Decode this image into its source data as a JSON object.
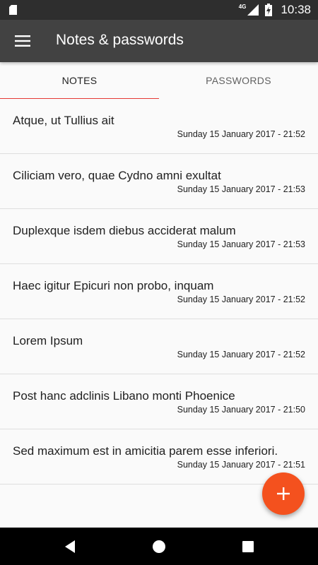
{
  "status_bar": {
    "network_label": "4G",
    "time": "10:38",
    "icons": [
      "sd-card-icon",
      "signal-icon",
      "battery-charging-icon"
    ]
  },
  "app_bar": {
    "title": "Notes & passwords",
    "menu_icon": "hamburger-menu-icon",
    "background": "#424242"
  },
  "tabs": [
    {
      "label": "NOTES",
      "selected": true
    },
    {
      "label": "PASSWORDS",
      "selected": false
    }
  ],
  "colors": {
    "accent": "#e53935",
    "fab": "#f4511e"
  },
  "notes": [
    {
      "title": "Atque, ut Tullius ait",
      "date": "Sunday 15 January 2017 - 21:52"
    },
    {
      "title": "Ciliciam vero, quae Cydno amni exultat",
      "date": "Sunday 15 January 2017 - 21:53"
    },
    {
      "title": "Duplexque isdem diebus acciderat malum",
      "date": "Sunday 15 January 2017 - 21:53"
    },
    {
      "title": "Haec igitur Epicuri non probo, inquam",
      "date": "Sunday 15 January 2017 - 21:52"
    },
    {
      "title": "Lorem Ipsum",
      "date": "Sunday 15 January 2017 - 21:52"
    },
    {
      "title": "Post hanc adclinis Libano monti Phoenice",
      "date": "Sunday 15 January 2017 - 21:50"
    },
    {
      "title": "Sed maximum est in amicitia parem esse inferiori.",
      "date": "Sunday 15 January 2017 - 21:51"
    }
  ],
  "fab": {
    "icon": "plus-icon"
  },
  "nav_bar": {
    "icons": [
      "back-icon",
      "home-icon",
      "recents-icon"
    ]
  }
}
